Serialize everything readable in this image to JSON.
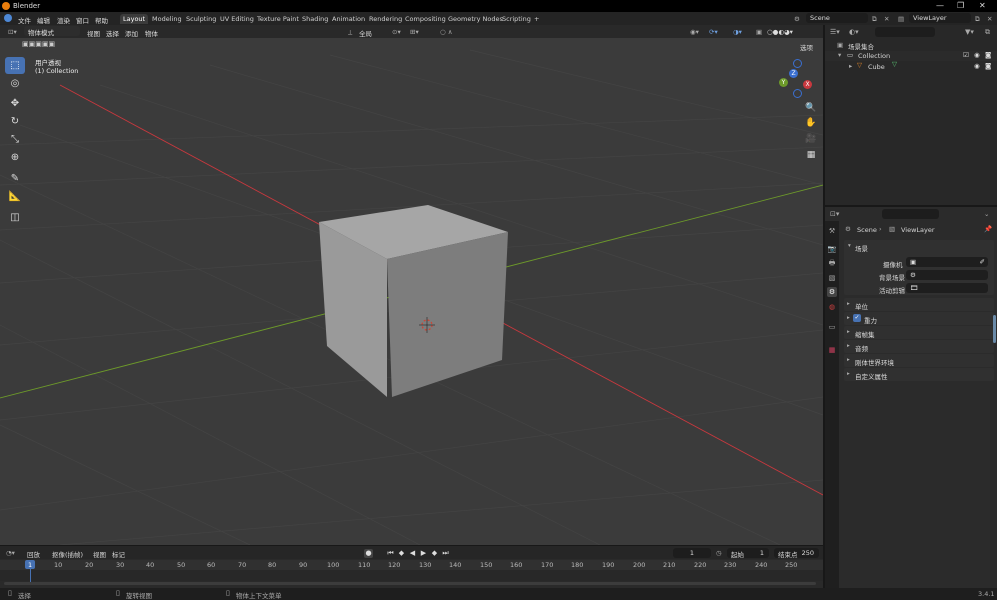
{
  "window": {
    "title": "Blender"
  },
  "topbar": {
    "menus": [
      "文件",
      "编辑",
      "渲染",
      "窗口",
      "帮助"
    ],
    "workspaces": [
      "Layout",
      "Modeling",
      "Sculpting",
      "UV Editing",
      "Texture Paint",
      "Shading",
      "Animation",
      "Rendering",
      "Compositing",
      "Geometry Nodes",
      "Scripting"
    ],
    "add_tab": "+",
    "scene": "Scene",
    "view_layer": "ViewLayer"
  },
  "viewport_header": {
    "mode": "物体模式",
    "menus": [
      "视图",
      "选择",
      "添加",
      "物体"
    ],
    "orientation": "全局",
    "options": "选项"
  },
  "viewport": {
    "view_name": "用户透视",
    "collection_info": "(1) Collection"
  },
  "outliner": {
    "root": "场景集合",
    "collection": "Collection",
    "object": "Cube"
  },
  "properties": {
    "breadcrumb_scene": "Scene",
    "breadcrumb_layer": "ViewLayer",
    "section": "场景",
    "fields": [
      {
        "label": "摄像机"
      },
      {
        "label": "背景场景"
      },
      {
        "label": "活动剪辑"
      }
    ],
    "panels": [
      "单位",
      "重力",
      "缩帧集",
      "音频",
      "刚体世界环境",
      "自定义属性"
    ],
    "gravity_checked": true
  },
  "timeline": {
    "menus": [
      "回放",
      "抠像(插帧)",
      "视图",
      "标记"
    ],
    "current_frame": "1",
    "start_label": "起始",
    "start": "1",
    "end_label": "结束点",
    "end": "250",
    "ticks": [
      "1",
      "10",
      "20",
      "30",
      "40",
      "50",
      "60",
      "70",
      "80",
      "90",
      "100",
      "110",
      "120",
      "130",
      "140",
      "150",
      "160",
      "170",
      "180",
      "190",
      "200",
      "210",
      "220",
      "230",
      "240",
      "250"
    ]
  },
  "statusbar": {
    "select": "选择",
    "rotate": "旋转视图",
    "context": "物体上下文菜单",
    "version": "3.4.1"
  },
  "colors": {
    "accent": "#4772b3",
    "x_axis": "#c9383e",
    "y_axis": "#6d9a2a",
    "z_axis": "#3a6fd0"
  }
}
